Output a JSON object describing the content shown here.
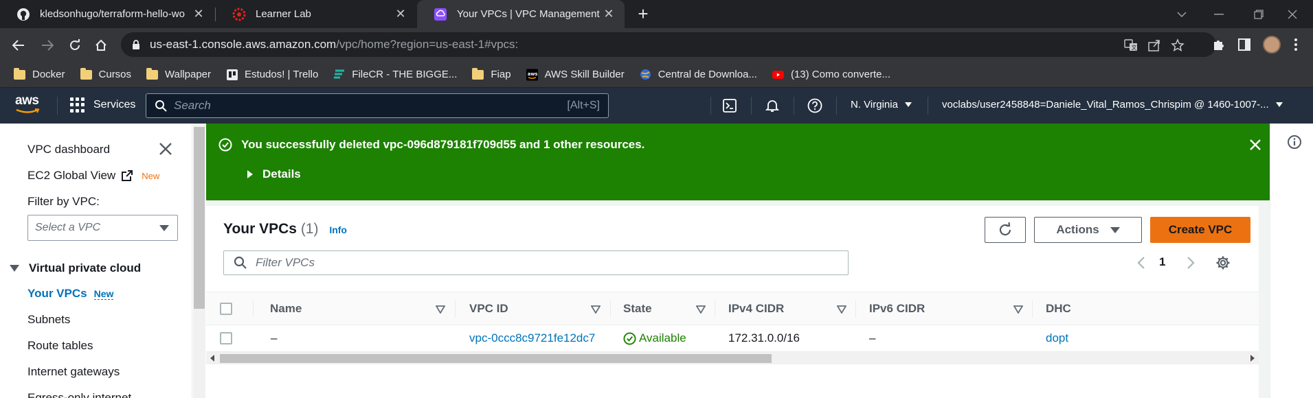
{
  "browser": {
    "tabs": [
      {
        "title": "kledsonhugo/terraform-hello-wo",
        "icon": "github-icon",
        "active": false
      },
      {
        "title": "Learner Lab",
        "icon": "canvas-icon",
        "active": false
      },
      {
        "title": "Your VPCs | VPC Management Co",
        "icon": "vpc-icon",
        "active": true
      }
    ],
    "new_tab": "+",
    "url_host": "us-east-1.console.aws.amazon.com",
    "url_rest": "/vpc/home?region=us-east-1#vpcs:",
    "bookmarks": [
      {
        "label": "Docker",
        "icon": "folder-icon"
      },
      {
        "label": "Cursos",
        "icon": "folder-icon"
      },
      {
        "label": "Wallpaper",
        "icon": "folder-icon"
      },
      {
        "label": "Estudos! | Trello",
        "icon": "trello-icon"
      },
      {
        "label": "FileCR - THE BIGGE...",
        "icon": "filecr-icon"
      },
      {
        "label": "Fiap",
        "icon": "folder-icon"
      },
      {
        "label": "AWS Skill Builder",
        "icon": "aws-icon"
      },
      {
        "label": "Central de Downloa...",
        "icon": "globe-icon"
      },
      {
        "label": "(13) Como converte...",
        "icon": "youtube-icon"
      }
    ]
  },
  "aws_nav": {
    "logo": "aws",
    "services_label": "Services",
    "search_placeholder": "Search",
    "search_shortcut": "[Alt+S]",
    "region": "N. Virginia",
    "account": "voclabs/user2458848=Daniele_Vital_Ramos_Chrispim @ 1460-1007-..."
  },
  "sidenav": {
    "dashboard": "VPC dashboard",
    "ec2_global_view": "EC2 Global View",
    "ec2_new_badge": "New",
    "filter_label": "Filter by VPC:",
    "filter_placeholder": "Select a VPC",
    "section_title": "Virtual private cloud",
    "your_vpcs": "Your VPCs",
    "your_vpcs_badge": "New",
    "items": [
      "Subnets",
      "Route tables",
      "Internet gateways",
      "Egress-only internet"
    ]
  },
  "flash": {
    "message": "You successfully deleted vpc-096d879181f709d55 and 1 other resources.",
    "details": "Details"
  },
  "panel": {
    "title": "Your VPCs",
    "count": "(1)",
    "info": "Info",
    "actions_label": "Actions",
    "create_label": "Create VPC",
    "filter_placeholder": "Filter VPCs",
    "page_number": "1"
  },
  "table": {
    "columns": [
      "Name",
      "VPC ID",
      "State",
      "IPv4 CIDR",
      "IPv6 CIDR",
      "DHC"
    ],
    "rows": [
      {
        "name": "–",
        "vpc_id": "vpc-0ccc8c9721fe12dc7",
        "state": "Available",
        "ipv4": "172.31.0.0/16",
        "ipv6": "–",
        "dhcp": "dopt"
      }
    ]
  },
  "colors": {
    "aws_nav_bg": "#232f3e",
    "success_green": "#1d8102",
    "primary_orange": "#ec7211",
    "link_blue": "#0073bb"
  }
}
